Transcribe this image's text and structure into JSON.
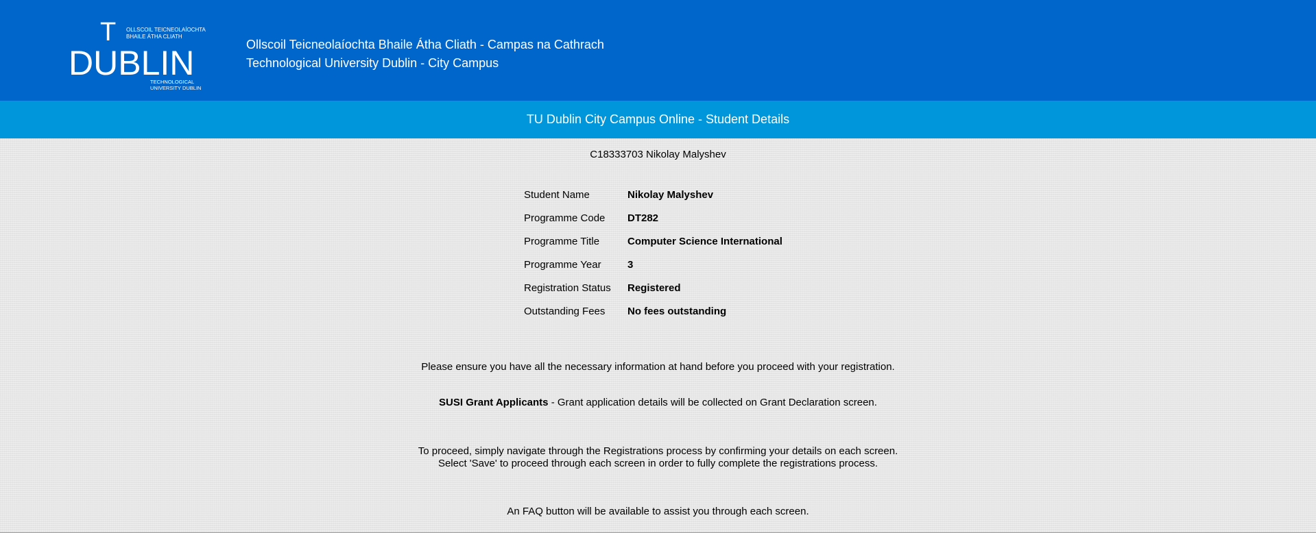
{
  "header": {
    "logo": {
      "letters_top": "T",
      "letters_main": "DUBLIN",
      "irish_name": [
        "OLLSCOIL TEICNEOLAÍOCHTA",
        "BHAILE ÁTHA CLIATH"
      ],
      "english_name": [
        "TECHNOLOGICAL",
        "UNIVERSITY DUBLIN"
      ]
    },
    "title_irish": "Ollscoil Teicneolaíochta Bhaile Átha Cliath - Campas na Cathrach",
    "title_english": "Technological University Dublin - City Campus",
    "background_color": "#0066cc"
  },
  "banner": {
    "title": "TU Dublin City Campus Online - Student Details",
    "background_color": "#0096db"
  },
  "student": {
    "id_line": "C18333703 Nikolay Malyshev",
    "details": [
      {
        "label": "Student Name",
        "value": "Nikolay Malyshev"
      },
      {
        "label": "Programme Code",
        "value": "DT282"
      },
      {
        "label": "Programme Title",
        "value": "Computer Science International"
      },
      {
        "label": "Programme Year",
        "value": "3"
      },
      {
        "label": "Registration Status",
        "value": "Registered"
      },
      {
        "label": "Outstanding Fees",
        "value": "No fees outstanding"
      }
    ]
  },
  "info": {
    "ensure_text": "Please ensure you have all the necessary information at hand before you proceed with your registration.",
    "susi_bold": "SUSI Grant Applicants",
    "susi_text": " - Grant application details will be collected on Grant Declaration screen.",
    "proceed_line1": "To proceed, simply navigate through the Registrations process by confirming your details on each screen.",
    "proceed_line2": "Select 'Save' to proceed through each screen in order to fully complete the registrations process.",
    "faq_text": "An FAQ button will be available to assist you through each screen."
  }
}
